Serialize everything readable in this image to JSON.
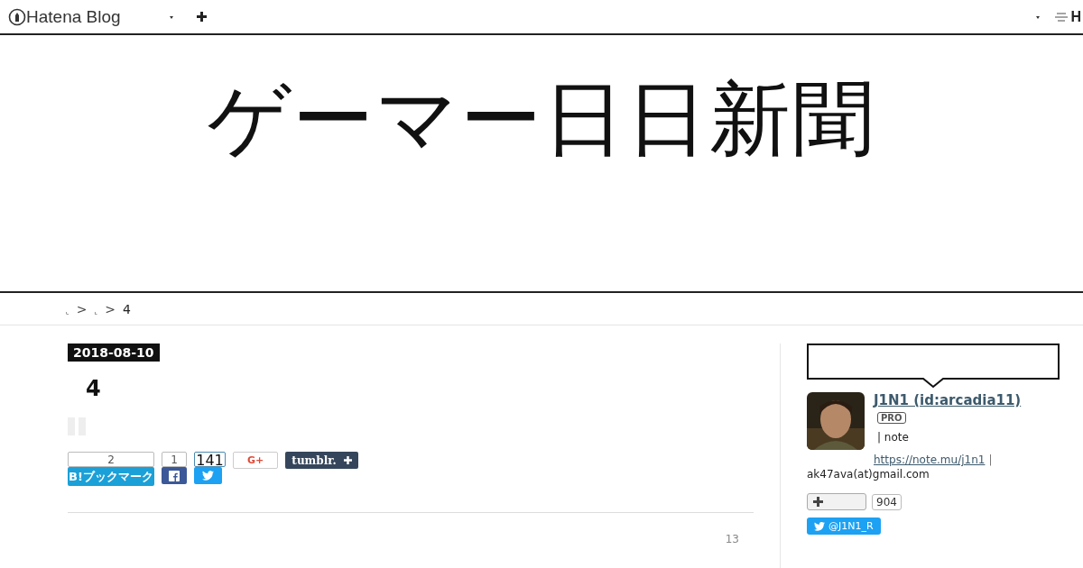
{
  "topbar": {
    "logo_text": "Hatena Blog",
    "right_text": "H"
  },
  "blog_title": "ゲーマー日日新聞",
  "breadcrumb": {
    "items": [
      "⌞",
      "⌞",
      "4"
    ],
    "separator": ">"
  },
  "entry": {
    "date": "2018-08-10",
    "title": "4",
    "share": [
      {
        "kind": "hatena",
        "count": "2",
        "label": "B!ブックマーク"
      },
      {
        "kind": "facebook",
        "count": "1"
      },
      {
        "kind": "twitter",
        "count": "141"
      },
      {
        "kind": "google",
        "label": "G+"
      },
      {
        "kind": "tumblr",
        "label": "tumblr."
      }
    ],
    "footer_count": "13"
  },
  "sidebar": {
    "user_name": "J1N1 (id:arcadia11)",
    "badge": "PRO",
    "bio_text": "| note",
    "bio_link": "https://note.mu/j1n1",
    "bio_sep": "|",
    "email": "ak47ava(at)gmail.com",
    "follow_count": "904",
    "twitter_handle": "@J1N1_R"
  }
}
